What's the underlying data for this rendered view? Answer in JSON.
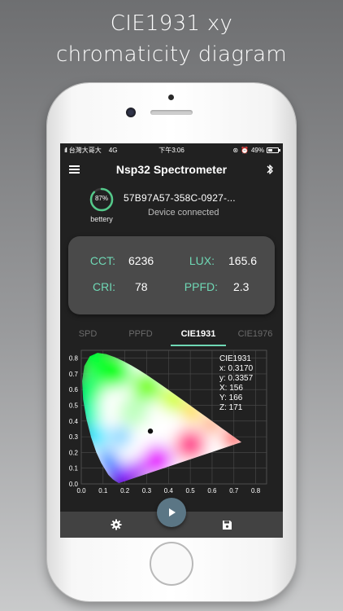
{
  "headline": {
    "line1": "CIE1931 xy",
    "line2": "chromaticity diagram"
  },
  "status_bar": {
    "carrier": "台灣大哥大",
    "network": "4G",
    "time": "下午3:06",
    "battery": "49%",
    "battery_level": 0.49
  },
  "app_bar": {
    "title": "Nsp32 Spectrometer",
    "menu_icon": "menu-icon",
    "bluetooth_icon": "bluetooth-icon"
  },
  "device": {
    "battery_percent": "87%",
    "battery_level": 0.87,
    "battery_label": "bettery",
    "id": "57B97A57-358C-0927-...",
    "status": "Device connected"
  },
  "metrics": {
    "cct": {
      "label": "CCT:",
      "value": "6236"
    },
    "lux": {
      "label": "LUX:",
      "value": "165.6"
    },
    "cri": {
      "label": "CRI:",
      "value": "78"
    },
    "ppfd": {
      "label": "PPFD:",
      "value": "2.3"
    }
  },
  "tabs": [
    {
      "label": "SPD",
      "active": false
    },
    {
      "label": "PPFD",
      "active": false
    },
    {
      "label": "CIE1931",
      "active": true
    },
    {
      "label": "CIE1976",
      "active": false
    }
  ],
  "chart_info": {
    "title": "CIE1931",
    "x": "x: 0.3170",
    "y": "y: 0.3357",
    "X": "X: 156",
    "Y": "Y: 166",
    "Z": "Z: 171"
  },
  "chart_data": {
    "type": "scatter",
    "title": "",
    "xlabel": "",
    "ylabel": "",
    "xlim": [
      0.0,
      0.85
    ],
    "ylim": [
      0.0,
      0.85
    ],
    "x_ticks": [
      "0.0",
      "0.1",
      "0.2",
      "0.3",
      "0.4",
      "0.5",
      "0.6",
      "0.7",
      "0.8"
    ],
    "y_ticks": [
      "0.0",
      "0.1",
      "0.2",
      "0.3",
      "0.4",
      "0.5",
      "0.6",
      "0.7",
      "0.8"
    ],
    "grid": true,
    "series": [
      {
        "x": [
          0.317
        ],
        "y": [
          0.3357
        ]
      }
    ]
  },
  "bottom_bar": {
    "settings_icon": "gear-icon",
    "play_icon": "play-icon",
    "save_icon": "save-icon"
  },
  "colors": {
    "accent": "#6fd8b5",
    "background": "#212121",
    "card": "#4a4a4a",
    "play": "#5b7685"
  }
}
